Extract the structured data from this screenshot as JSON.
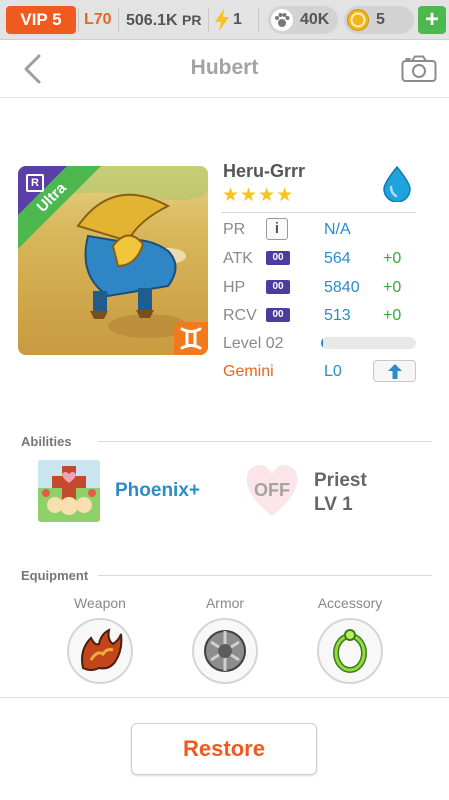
{
  "topbar": {
    "vip": "VIP 5",
    "level": "L70",
    "power": "506.1K",
    "power_unit": "PR",
    "energy": "1",
    "food": "40K",
    "gold": "5",
    "add": "+"
  },
  "header": {
    "back_icon": "chevron-left-icon",
    "title": "Hubert",
    "camera_icon": "camera-icon"
  },
  "monster": {
    "name": "Heru-Grrr",
    "stars": "★★★★",
    "rarity": "Ultra",
    "rarity_letter": "R",
    "element_icon": "water-drop-icon",
    "zodiac_icon": "gemini-icon",
    "stats": {
      "pr_label": "PR",
      "pr_info": "i",
      "pr_value": "N/A",
      "atk_label": "ATK",
      "atk_badge": "00",
      "atk_value": "564",
      "atk_plus": "+0",
      "hp_label": "HP",
      "hp_badge": "00",
      "hp_value": "5840",
      "hp_plus": "+0",
      "rcv_label": "RCV",
      "rcv_badge": "00",
      "rcv_value": "513",
      "rcv_plus": "+0",
      "level_label": "Level 02",
      "level_progress": 0.02,
      "zodiac_label": "Gemini",
      "zodiac_level": "L0"
    }
  },
  "abilities": {
    "section_title": "Abilities",
    "skill_name": "Phoenix+",
    "toggle": "OFF",
    "class_name": "Priest",
    "class_level": "LV 1"
  },
  "equipment": {
    "section_title": "Equipment",
    "slots": [
      {
        "label": "Weapon"
      },
      {
        "label": "Armor"
      },
      {
        "label": "Accessory"
      }
    ]
  },
  "footer": {
    "restore": "Restore"
  },
  "colors": {
    "accent_orange": "#f05a1f",
    "blue": "#2b8cc9",
    "green": "#4cb84f",
    "purple": "#4a3d9e"
  }
}
